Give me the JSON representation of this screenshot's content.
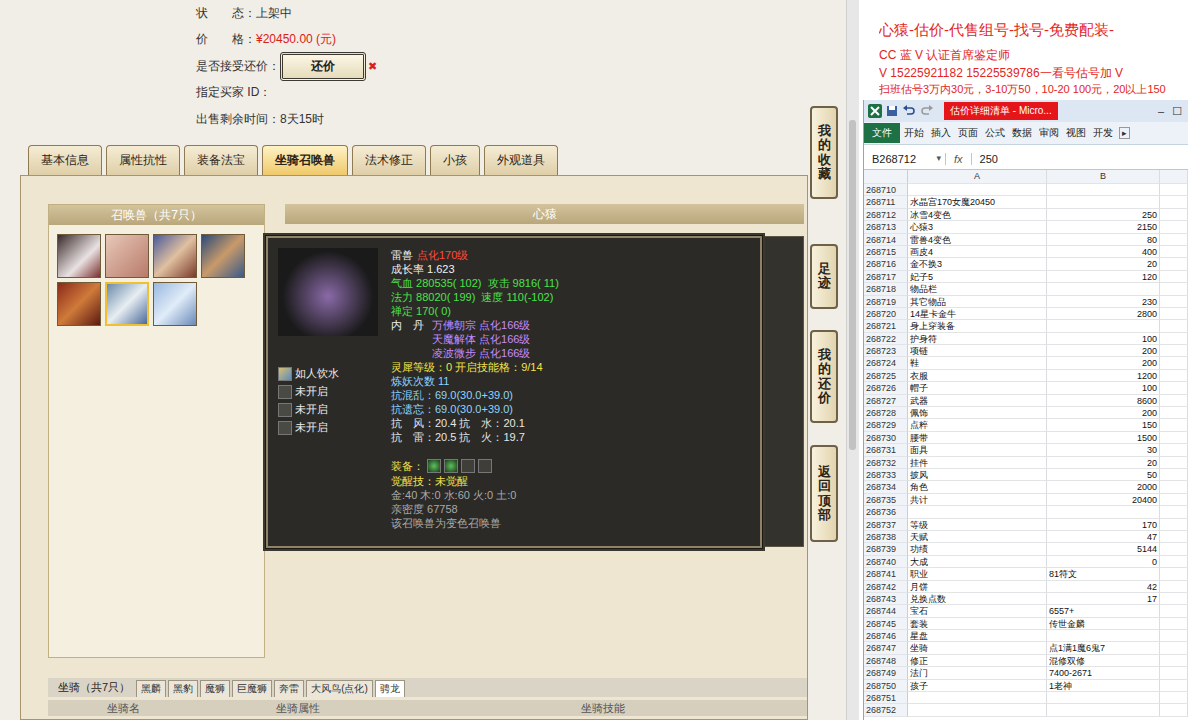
{
  "listing": {
    "fields": [
      {
        "label": "状　　态：",
        "value": "上架中",
        "kind": "text"
      },
      {
        "label": "价　　格：",
        "value": "¥20450.00 (元)",
        "kind": "price"
      },
      {
        "label": "是否接受还价：",
        "value": "还价",
        "kind": "button",
        "close": "✖"
      },
      {
        "label": "指定买家 ID：",
        "value": "",
        "kind": "text"
      },
      {
        "label": "出售剩余时间：",
        "value": "8天15时",
        "kind": "text"
      }
    ]
  },
  "tabs": [
    {
      "label": "基本信息",
      "selected": false
    },
    {
      "label": "属性抗性",
      "selected": false
    },
    {
      "label": "装备法宝",
      "selected": false
    },
    {
      "label": "坐骑召唤兽",
      "selected": true
    },
    {
      "label": "法术修正",
      "selected": false
    },
    {
      "label": "小孩",
      "selected": false
    },
    {
      "label": "外观道具",
      "selected": false
    }
  ],
  "side_buttons": [
    "我的收藏",
    "足迹",
    "我的还价",
    "返回顶部"
  ],
  "pets": {
    "title": "召唤兽（共7只）",
    "items": [
      {
        "selected": false
      },
      {
        "selected": false
      },
      {
        "selected": false
      },
      {
        "selected": false
      },
      {
        "selected": false
      },
      {
        "selected": true
      },
      {
        "selected": false
      }
    ]
  },
  "pet_panel": {
    "title": "心猿"
  },
  "tooltip": {
    "name": "雷兽",
    "name_note": "点化170级",
    "growth": "成长率 1.623",
    "stats": [
      {
        "cells": [
          "气血 280535( 102)",
          "攻击 9816( 11)"
        ]
      },
      {
        "cells": [
          "法力 88020( 199)",
          "速度 110(-102)"
        ]
      },
      {
        "cells": [
          "禅定 170( 0)"
        ]
      }
    ],
    "neidan": {
      "label": "内　丹",
      "items": [
        "万佛朝宗 点化166级",
        "天魔解体 点化166级",
        "凌波微步 点化166级"
      ]
    },
    "lines": [
      {
        "text": "灵犀等级：0  开启技能格：9/14",
        "kind": "yellow"
      },
      {
        "text": "炼妖次数 11",
        "kind": "blue"
      },
      {
        "text": "抗混乱：69.0(30.0+39.0)",
        "kind": "blue"
      },
      {
        "text": "抗遗忘：69.0(30.0+39.0)",
        "kind": "blue"
      },
      {
        "text": "抗　风：20.4  抗　水：20.1",
        "kind": "plain"
      },
      {
        "text": "抗　雷：20.5  抗　火：19.7",
        "kind": "plain"
      }
    ],
    "equip": {
      "label": "装备：",
      "slots": [
        {
          "filled": true
        },
        {
          "filled": true
        },
        {
          "filled": false
        },
        {
          "filled": false
        }
      ]
    },
    "tail": [
      {
        "text": "觉醒技：未觉醒",
        "kind": "yellow"
      },
      {
        "text": "金:40 木:0 水:60 火:0 土:0",
        "kind": "grey"
      },
      {
        "text": "亲密度 67758",
        "kind": "grey"
      },
      {
        "text": "该召唤兽为变色召唤兽",
        "kind": "grey"
      }
    ],
    "skills": [
      {
        "name": "如人饮水",
        "open": true
      },
      {
        "name": "未开启",
        "open": false
      },
      {
        "name": "未开启",
        "open": false
      },
      {
        "name": "未开启",
        "open": false
      }
    ]
  },
  "mounts": {
    "title": "坐骑（共7只）",
    "tabs": [
      {
        "label": "黑麟",
        "selected": false
      },
      {
        "label": "黑豹",
        "selected": false
      },
      {
        "label": "魔狮",
        "selected": false
      },
      {
        "label": "巨魔狮",
        "selected": false
      },
      {
        "label": "奔雷",
        "selected": false
      },
      {
        "label": "大风鸟(点化)",
        "selected": false
      },
      {
        "label": "骋龙",
        "selected": true
      }
    ],
    "columns": [
      "坐骑名",
      "坐骑属性",
      "坐骑技能"
    ]
  },
  "promo": {
    "lines": [
      "心猿-估价-代售组号-找号-免费配装-",
      "CC 蓝 V 认证首席鉴定师",
      "V 15225921182  15225539786一看号估号加 V",
      "扫班估号3万内30元，3-10万50，10-20 100元，20以上150"
    ]
  },
  "excel": {
    "title": "估价详细清单 - Micro...",
    "controls": [
      "–",
      "☐"
    ],
    "ribbon_tabs": [
      {
        "label": "文件",
        "selected": true
      },
      {
        "label": "开始",
        "selected": false
      },
      {
        "label": "插入",
        "selected": false
      },
      {
        "label": "页面",
        "selected": false
      },
      {
        "label": "公式",
        "selected": false
      },
      {
        "label": "数据",
        "selected": false
      },
      {
        "label": "审阅",
        "selected": false
      },
      {
        "label": "视图",
        "selected": false
      },
      {
        "label": "开发",
        "selected": false
      }
    ],
    "ribbon_more": "▸",
    "name_box": "B268712",
    "name_arrow": "▾",
    "fx": "fx",
    "formula": "250",
    "columns": [
      "A",
      "B"
    ],
    "rows": [
      {
        "n": "268710",
        "a": "",
        "b": "",
        "kind": "num"
      },
      {
        "n": "268711",
        "a": "水晶宫170女魔20450",
        "b": "",
        "kind": "num"
      },
      {
        "n": "268712",
        "a": "冰雪4变色",
        "b": "250",
        "kind": "num"
      },
      {
        "n": "268713",
        "a": "心猿3",
        "b": "2150",
        "kind": "num"
      },
      {
        "n": "268714",
        "a": "雷兽4变色",
        "b": "80",
        "kind": "num"
      },
      {
        "n": "268715",
        "a": "画皮4",
        "b": "400",
        "kind": "num"
      },
      {
        "n": "268716",
        "a": "金不换3",
        "b": "20",
        "kind": "num"
      },
      {
        "n": "268717",
        "a": "妃子5",
        "b": "120",
        "kind": "num"
      },
      {
        "n": "268718",
        "a": "物品栏",
        "b": "",
        "kind": "num"
      },
      {
        "n": "268719",
        "a": "其它物品",
        "b": "230",
        "kind": "num"
      },
      {
        "n": "268720",
        "a": "14星卡金牛",
        "b": "2800",
        "kind": "num"
      },
      {
        "n": "268721",
        "a": "身上穿装备",
        "b": "",
        "kind": "num"
      },
      {
        "n": "268722",
        "a": "护身符",
        "b": "100",
        "kind": "num"
      },
      {
        "n": "268723",
        "a": "项链",
        "b": "200",
        "kind": "num"
      },
      {
        "n": "268724",
        "a": "鞋",
        "b": "200",
        "kind": "num"
      },
      {
        "n": "268725",
        "a": "衣服",
        "b": "1200",
        "kind": "num"
      },
      {
        "n": "268726",
        "a": "帽子",
        "b": "100",
        "kind": "num"
      },
      {
        "n": "268727",
        "a": "武器",
        "b": "8600",
        "kind": "num"
      },
      {
        "n": "268728",
        "a": "佩饰",
        "b": "200",
        "kind": "num"
      },
      {
        "n": "268729",
        "a": "点粹",
        "b": "150",
        "kind": "num"
      },
      {
        "n": "268730",
        "a": "腰带",
        "b": "1500",
        "kind": "num"
      },
      {
        "n": "268731",
        "a": "面具",
        "b": "30",
        "kind": "num"
      },
      {
        "n": "268732",
        "a": "挂件",
        "b": "20",
        "kind": "num"
      },
      {
        "n": "268733",
        "a": "披风",
        "b": "50",
        "kind": "num"
      },
      {
        "n": "268734",
        "a": "角色",
        "b": "2000",
        "kind": "num"
      },
      {
        "n": "268735",
        "a": "共计",
        "b": "20400",
        "kind": "num"
      },
      {
        "n": "268736",
        "a": "",
        "b": "",
        "kind": "num"
      },
      {
        "n": "268737",
        "a": "等级",
        "b": "170",
        "kind": "num"
      },
      {
        "n": "268738",
        "a": "天赋",
        "b": "47",
        "kind": "num"
      },
      {
        "n": "268739",
        "a": "功绩",
        "b": "5144",
        "kind": "num"
      },
      {
        "n": "268740",
        "a": "大成",
        "b": "0",
        "kind": "num"
      },
      {
        "n": "268741",
        "a": "职业",
        "b": "81符文",
        "kind": "text"
      },
      {
        "n": "268742",
        "a": "月饼",
        "b": "42",
        "kind": "num"
      },
      {
        "n": "268743",
        "a": "兑换点数",
        "b": "17",
        "kind": "num"
      },
      {
        "n": "268744",
        "a": "宝石",
        "b": "6557+",
        "kind": "text"
      },
      {
        "n": "268745",
        "a": "套装",
        "b": "传世金麟",
        "kind": "text"
      },
      {
        "n": "268746",
        "a": "星盘",
        "b": "",
        "kind": "text"
      },
      {
        "n": "268747",
        "a": "坐骑",
        "b": "点1满1魔6鬼7",
        "kind": "text"
      },
      {
        "n": "268748",
        "a": "修正",
        "b": "混修双修",
        "kind": "text"
      },
      {
        "n": "268749",
        "a": "法门",
        "b": "7400-2671",
        "kind": "text"
      },
      {
        "n": "268750",
        "a": "孩子",
        "b": "1老神",
        "kind": "text"
      },
      {
        "n": "268751",
        "a": "",
        "b": "",
        "kind": "num"
      },
      {
        "n": "268752",
        "a": "",
        "b": "",
        "kind": "num"
      }
    ]
  }
}
